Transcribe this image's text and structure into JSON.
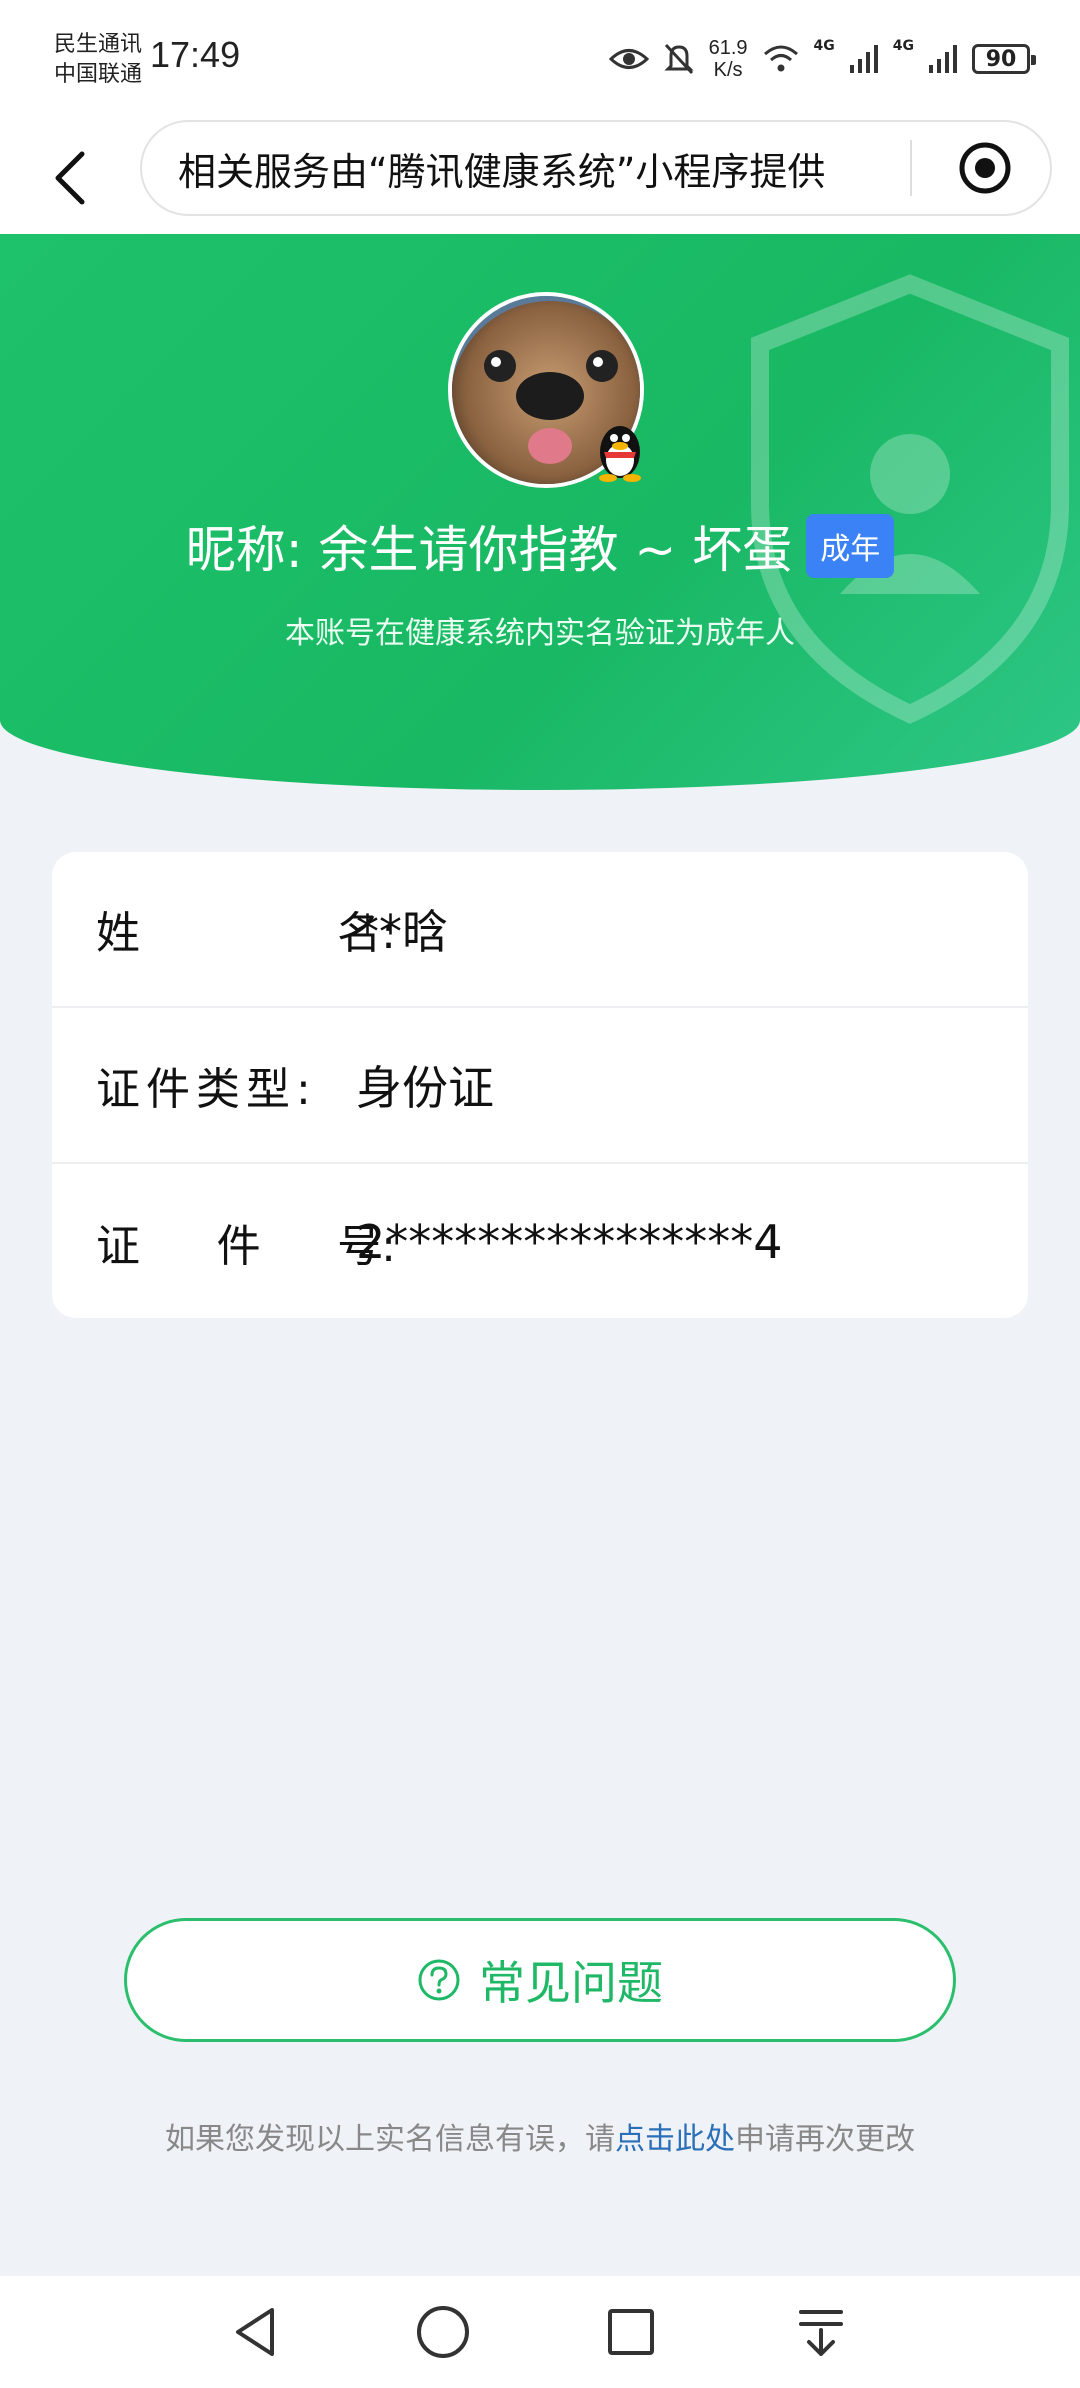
{
  "status_bar": {
    "carrier_line1": "民生通讯",
    "carrier_line2": "中国联通",
    "time": "17:49",
    "speed_value": "61.9",
    "speed_unit": "K/s",
    "net1": "4G",
    "net2": "4G",
    "battery": "90"
  },
  "nav": {
    "capsule_text": "相关服务由“腾讯健康系统”小程序提供"
  },
  "profile": {
    "nickname": "昵称: 余生请你指教 ~ 坏蛋",
    "badge": "成年",
    "verify_note": "本账号在健康系统内实名验证为成年人"
  },
  "info": {
    "name_label_1": "姓",
    "name_label_2": "名:",
    "name_value": "**晗",
    "id_type_label": "证件类型:",
    "id_type_value": "身份证",
    "id_no_label_1": "证",
    "id_no_label_2": "件",
    "id_no_label_3": "号:",
    "id_no_value": "2****************4"
  },
  "faq": {
    "label": "常见问题"
  },
  "footer": {
    "prefix": "如果您发现以上实名信息有误，请",
    "link": "点击此处",
    "suffix": "申请再次更改"
  },
  "colors": {
    "header_green": "#1ec26a",
    "badge_blue": "#3b82f6",
    "faq_green": "#1fb866",
    "link_blue": "#2b6fb8"
  }
}
